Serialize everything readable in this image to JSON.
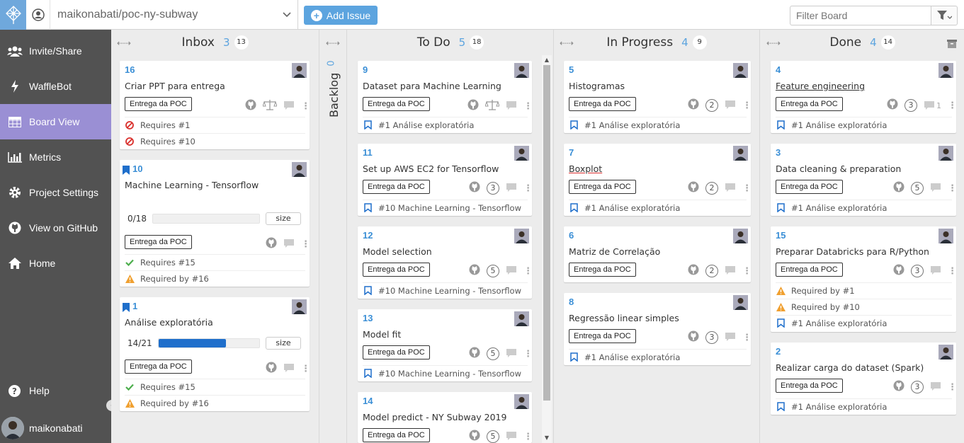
{
  "topbar": {
    "repo": "maikonabati/poc-ny-subway",
    "add_issue": "Add Issue",
    "filter_placeholder": "Filter Board"
  },
  "sidebar": {
    "items": [
      {
        "label": "Invite/Share",
        "icon": "users-icon"
      },
      {
        "label": "WaffleBot",
        "icon": "bolt-icon"
      },
      {
        "label": "Board View",
        "icon": "table-icon",
        "active": true
      },
      {
        "label": "Metrics",
        "icon": "bar-chart-icon"
      },
      {
        "label": "Project Settings",
        "icon": "gear-icon"
      },
      {
        "label": "View on GitHub",
        "icon": "github-icon"
      },
      {
        "label": "Home",
        "icon": "home-icon"
      }
    ],
    "help": "Help",
    "user": "maikonabati"
  },
  "backlog": {
    "title": "Backlog",
    "count": "0"
  },
  "columns": {
    "inbox": {
      "title": "Inbox",
      "count": "3",
      "total": "13"
    },
    "todo": {
      "title": "To Do",
      "count": "5",
      "total": "18"
    },
    "progress": {
      "title": "In Progress",
      "count": "4",
      "total": "9"
    },
    "done": {
      "title": "Done",
      "count": "4",
      "total": "14"
    }
  },
  "cards": {
    "i16": {
      "num": "16",
      "title": "Criar PPT para entrega",
      "label": "Entrega da POC",
      "rel1": "Requires #1",
      "rel2": "Requires #10"
    },
    "i10": {
      "num": "10",
      "title": "Machine Learning - Tensorflow",
      "progress": "0/18",
      "progress_value": 0,
      "size": "size",
      "label": "Entrega da POC",
      "rel1": "Requires #15",
      "rel2": "Required by #16"
    },
    "i1": {
      "num": "1",
      "title": "Análise exploratória",
      "progress": "14/21",
      "progress_value": 0.667,
      "size": "size",
      "label": "Entrega da POC",
      "rel1": "Requires #15",
      "rel2": "Required by #16"
    },
    "t9": {
      "num": "9",
      "title": "Dataset para Machine Learning",
      "label": "Entrega da POC",
      "epic": "#1 Análise exploratória"
    },
    "t11": {
      "num": "11",
      "title": "Set up AWS EC2 for Tensorflow",
      "label": "Entrega da POC",
      "points": "3",
      "epic": "#10 Machine Learning - Tensorflow"
    },
    "t12": {
      "num": "12",
      "title": "Model selection",
      "label": "Entrega da POC",
      "points": "5",
      "epic": "#10 Machine Learning - Tensorflow"
    },
    "t13": {
      "num": "13",
      "title": "Model fit",
      "label": "Entrega da POC",
      "points": "5",
      "epic": "#10 Machine Learning - Tensorflow"
    },
    "t14": {
      "num": "14",
      "title": "Model predict - NY Subway 2019",
      "label": "Entrega da POC",
      "points": "5"
    },
    "p5": {
      "num": "5",
      "title": "Histogramas",
      "label": "Entrega da POC",
      "points": "2",
      "epic": "#1 Análise exploratória"
    },
    "p7": {
      "num": "7",
      "title": "Boxplot",
      "label": "Entrega da POC",
      "points": "2",
      "epic": "#1 Análise exploratória"
    },
    "p6": {
      "num": "6",
      "title": "Matriz de Correlação",
      "label": "Entrega da POC",
      "points": "2"
    },
    "p8": {
      "num": "8",
      "title": "Regressão linear simples",
      "label": "Entrega da POC",
      "points": "3",
      "epic": "#1 Análise exploratória"
    },
    "d4": {
      "num": "4",
      "title": "Feature engineering",
      "label": "Entrega da POC",
      "points": "3",
      "comments": "1",
      "epic": "#1 Análise exploratória"
    },
    "d3": {
      "num": "3",
      "title": "Data cleaning & preparation",
      "label": "Entrega da POC",
      "points": "5",
      "epic": "#1 Análise exploratória"
    },
    "d15": {
      "num": "15",
      "title": "Preparar Databricks para R/Python",
      "label": "Entrega da POC",
      "points": "3",
      "rel1": "Required by #1",
      "rel2": "Required by #10",
      "epic": "#1 Análise exploratória"
    },
    "d2": {
      "num": "2",
      "title": "Realizar carga do dataset (Spark)",
      "label": "Entrega da POC",
      "points": "3",
      "epic": "#1 Análise exploratória"
    }
  }
}
